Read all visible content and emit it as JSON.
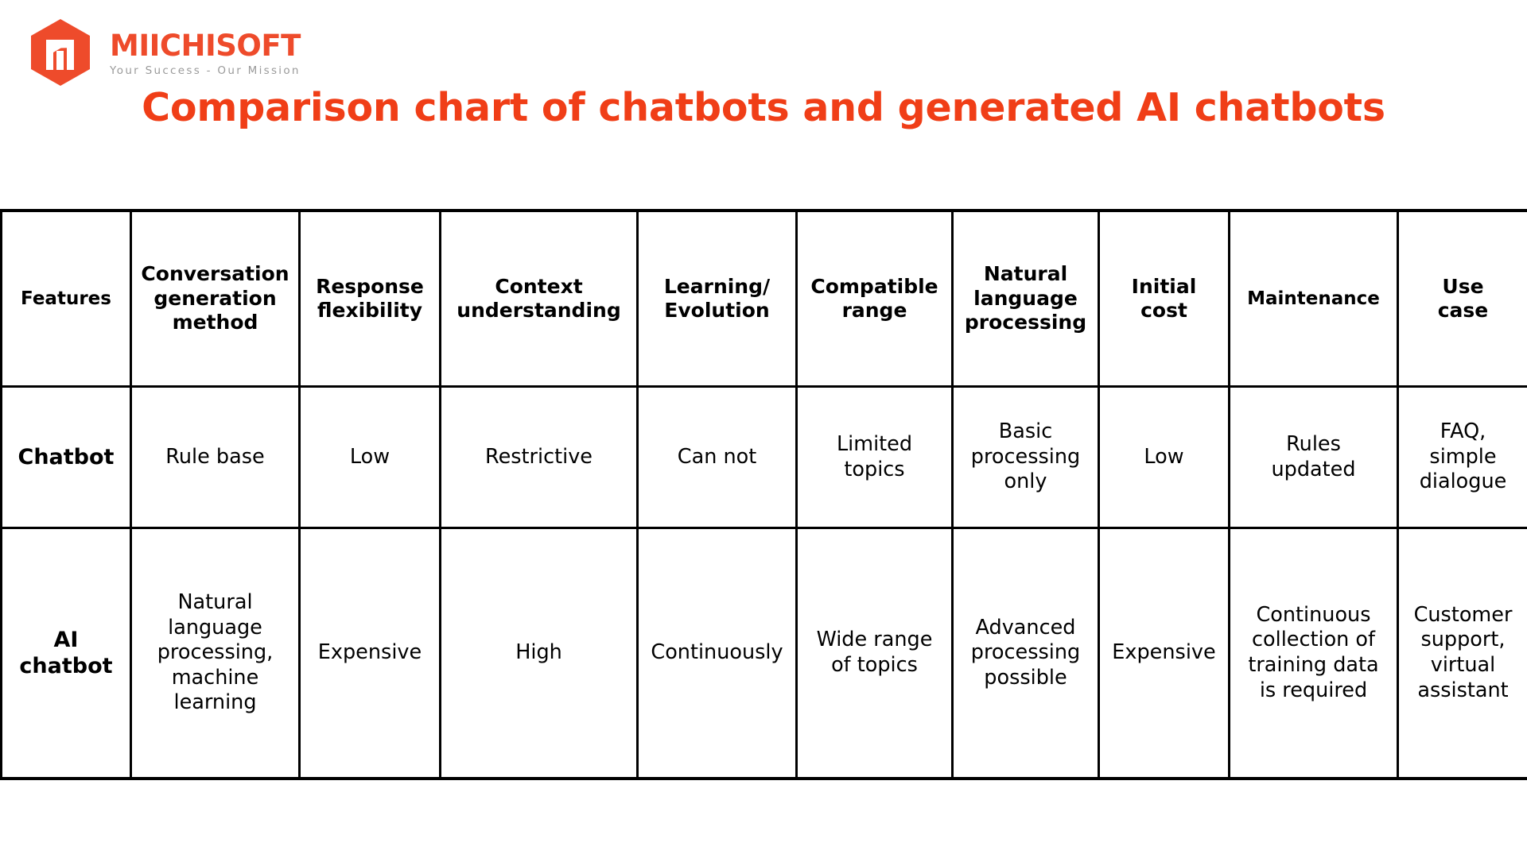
{
  "brand": {
    "logo_icon": "miichisoft-hexagon-m-logo",
    "name": "MIICHISOFT",
    "tagline": "Your Success - Our Mission",
    "brand_color": "#EE4B2B",
    "tagline_color": "#9A9A9A"
  },
  "title": {
    "text": "Comparison chart of chatbots and generated AI chatbots",
    "color": "#F03E17"
  },
  "chart_data": {
    "type": "table",
    "title": "Comparison chart of chatbots and generated AI chatbots",
    "columns": [
      "Features",
      "Conversation generation method",
      "Response flexibility",
      "Context understanding",
      "Learning/ Evolution",
      "Compatible range",
      "Natural language processing",
      "Initial cost",
      "Maintenance",
      "Use case"
    ],
    "rows": [
      {
        "label": "Chatbot",
        "values": [
          "Rule base",
          "Low",
          "Restrictive",
          "Can not",
          "Limited topics",
          "Basic processing only",
          "Low",
          "Rules updated",
          "FAQ, simple dialogue"
        ]
      },
      {
        "label": "AI chatbot",
        "values": [
          "Natural language processing, machine learning",
          "Expensive",
          "High",
          "Continuously",
          "Wide range of topics",
          "Advanced processing possible",
          "Expensive",
          "Continuous collection of training data is required",
          "Customer support, virtual assistant"
        ]
      }
    ]
  },
  "table": {
    "headers": [
      {
        "line1": "Features",
        "line2": "",
        "line3": ""
      },
      {
        "line1": "Conversation",
        "line2": "generation",
        "line3": "method"
      },
      {
        "line1": "Response",
        "line2": "flexibility",
        "line3": ""
      },
      {
        "line1": "Context",
        "line2": "understanding",
        "line3": ""
      },
      {
        "line1": "Learning/",
        "line2": "Evolution",
        "line3": ""
      },
      {
        "line1": "Compatible",
        "line2": "range",
        "line3": ""
      },
      {
        "line1": "Natural",
        "line2": "language",
        "line3": "processing"
      },
      {
        "line1": "Initial",
        "line2": "cost",
        "line3": ""
      },
      {
        "line1": "Maintenance",
        "line2": "",
        "line3": ""
      },
      {
        "line1": "Use",
        "line2": "case",
        "line3": ""
      }
    ],
    "chatbot_row": {
      "label": "Chatbot",
      "conversation_generation_method": "Rule base",
      "response_flexibility": "Low",
      "context_understanding": "Restrictive",
      "learning_evolution": "Can not",
      "compatible_range": "Limited\ntopics",
      "natural_language_processing": "Basic\nprocessing\nonly",
      "initial_cost": "Low",
      "maintenance": "Rules\nupdated",
      "use_case": "FAQ,\nsimple\ndialogue"
    },
    "ai_chatbot_row": {
      "label": "AI\nchatbot",
      "conversation_generation_method": "Natural\nlanguage\nprocessing,\nmachine\nlearning",
      "response_flexibility": "Expensive",
      "context_understanding": "High",
      "learning_evolution": "Continuously",
      "compatible_range": "Wide range\nof topics",
      "natural_language_processing": "Advanced\nprocessing\npossible",
      "initial_cost": "Expensive",
      "maintenance": "Continuous\ncollection of\ntraining data\nis required",
      "use_case": "Customer\nsupport,\nvirtual\nassistant"
    }
  }
}
